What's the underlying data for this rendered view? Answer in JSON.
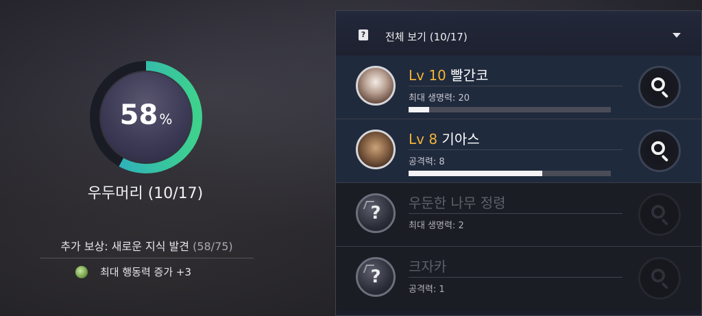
{
  "progress": {
    "percent": 58,
    "percent_sign": "%",
    "colors": {
      "ring_start": "#2aa6c8",
      "ring_end": "#3ed28d",
      "track": "#1a1c25"
    }
  },
  "region": {
    "title": "우두머리 (10/17)"
  },
  "bonus": {
    "label": "추가 보상: 새로운 지식 발견",
    "count": "(58/75)"
  },
  "reward": {
    "icon": "leaf-token-icon",
    "text": "최대 행동력 증가 +3"
  },
  "panel": {
    "title": "전체 보기 (10/17)",
    "icon": "book-icon",
    "entries": [
      {
        "state": "found",
        "lv": "Lv 10",
        "name": "빨간코",
        "stat": "최대 생명력: 20",
        "progress": 0.1
      },
      {
        "state": "found",
        "lv": "Lv 8",
        "name": "기아스",
        "stat": "공격력: 8",
        "progress": 0.66
      },
      {
        "state": "locked",
        "lv": "",
        "name": "우둔한 나무 정령",
        "stat": "최대 생명력: 2",
        "portrait": "?"
      },
      {
        "state": "locked",
        "lv": "",
        "name": "크자카",
        "stat": "공격력: 1",
        "portrait": "?"
      }
    ]
  }
}
